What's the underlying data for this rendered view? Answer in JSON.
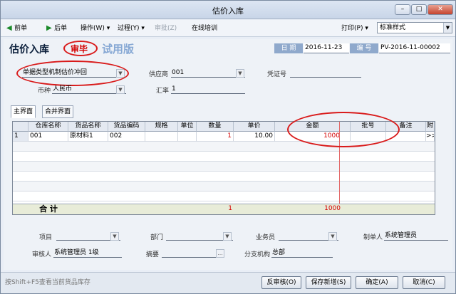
{
  "window": {
    "title": "估价入库",
    "min": "–",
    "max": "□",
    "close": "✕"
  },
  "toolbar": {
    "prev": "前单",
    "next": "后单",
    "operation": "操作(W)",
    "process": "过程(Y)",
    "unapprove": "审批(Z)",
    "training": "在线培训",
    "print": "打印(P)",
    "style_value": "标准样式"
  },
  "header": {
    "title": "估价入库",
    "status_stamp": "审毕",
    "trial": "试用版",
    "date_label": "日 期",
    "date_value": "2016-11-23",
    "no_label": "编 号",
    "no_value": "PV-2016-11-00002"
  },
  "fields": {
    "doc_type": "单据类型机制估价冲回",
    "supplier_label": "供应商",
    "supplier_value": "001",
    "voucher_label": "凭证号",
    "voucher_value": "",
    "currency_label": "币种",
    "currency_value": "人民币",
    "rate_label": "汇率",
    "rate_value": "1"
  },
  "tabs": {
    "main": "主界面",
    "merge": "合并界面"
  },
  "grid": {
    "columns": [
      "仓库名称",
      "货品名称",
      "货品编码",
      "规格",
      "单位",
      "数量",
      "单价",
      "金额",
      "批号",
      "备注",
      "附"
    ],
    "row1": {
      "no": "1",
      "warehouse": "001",
      "product": "原材料1",
      "code": "002",
      "spec": "",
      "unit": "",
      "qty": "1",
      "price": "10.00",
      "amount": "1000",
      "batch": "",
      "remark": "",
      "attach": ">>"
    },
    "total_label": "合 计",
    "total_qty": "1",
    "total_amount": "1000"
  },
  "footer": {
    "project_label": "项目",
    "dept_label": "部门",
    "staff_label": "业务员",
    "maker_label": "制单人",
    "maker_value": "系统管理员",
    "auditor_label": "审核人",
    "auditor_value": "系统管理员 1级",
    "summary_label": "摘要",
    "branch_label": "分支机构",
    "branch_value": "总部"
  },
  "status": {
    "hint": "按Shift+F5查看当前货品库存"
  },
  "buttons": {
    "unaudit": "反审核(O)",
    "save_new": "保存新增(S)",
    "ok": "确定(A)",
    "cancel": "取消(C)"
  }
}
